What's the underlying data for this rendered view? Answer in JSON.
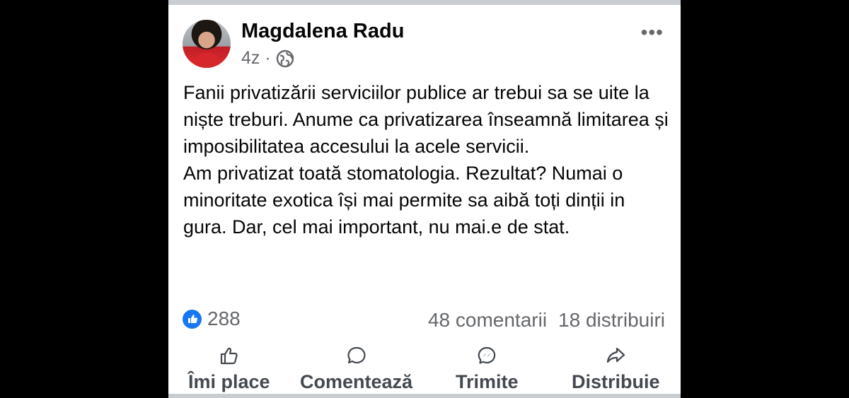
{
  "post": {
    "author": "Magdalena Radu",
    "time": "4z",
    "separator": "·",
    "more_label": "•••",
    "paragraphs": [
      "Fanii privatizării serviciilor publice ar trebui sa se uite la niște treburi. Anume ca privatizarea înseamnă limitarea și imposibilitatea accesului la acele servicii.",
      "Am privatizat toată stomatologia. Rezultat? Numai o minoritate exotica își mai permite sa aibă toți dinții in gura. Dar, cel mai important, nu mai.e de stat."
    ]
  },
  "stats": {
    "likes": "288",
    "comments": "48 comentarii",
    "shares": "18 distribuiri"
  },
  "actions": {
    "like": "Îmi place",
    "comment": "Comentează",
    "send": "Trimite",
    "share": "Distribuie"
  },
  "colors": {
    "accent": "#1877f2",
    "secondary_text": "#65676b",
    "action_text": "#444950",
    "divider": "#c9ccd1"
  }
}
